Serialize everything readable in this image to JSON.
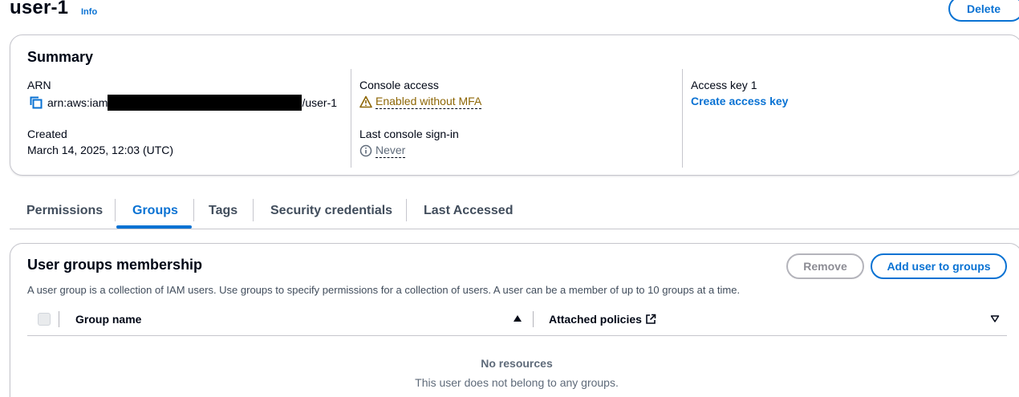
{
  "header": {
    "title": "user-1",
    "info_label": "Info",
    "delete_label": "Delete"
  },
  "summary": {
    "title": "Summary",
    "arn_label": "ARN",
    "arn_prefix": "arn:aws:iam",
    "arn_suffix": "/user-1",
    "created_label": "Created",
    "created_value": "March 14, 2025, 12:03 (UTC)",
    "console_access_label": "Console access",
    "console_access_value": "Enabled without MFA",
    "last_signin_label": "Last console sign-in",
    "last_signin_value": "Never",
    "access_key_label": "Access key 1",
    "create_access_key_label": "Create access key"
  },
  "tabs": [
    {
      "label": "Permissions",
      "active": false
    },
    {
      "label": "Groups",
      "active": true
    },
    {
      "label": "Tags",
      "active": false
    },
    {
      "label": "Security credentials",
      "active": false
    },
    {
      "label": "Last Accessed",
      "active": false
    }
  ],
  "groups": {
    "title": "User groups membership",
    "description": "A user group is a collection of IAM users. Use groups to specify permissions for a collection of users. A user can be a member of up to 10 groups at a time.",
    "remove_label": "Remove",
    "add_label": "Add user to groups",
    "columns": [
      "Group name",
      "Attached policies"
    ],
    "empty_title": "No resources",
    "empty_desc": "This user does not belong to any groups."
  },
  "colors": {
    "link": "#0972d3",
    "warning": "#8d6605",
    "muted": "#5f6b7a",
    "border": "#c6c6cd"
  },
  "icons": [
    "copy-icon",
    "warning-icon",
    "info-circle-icon",
    "sort-ascending-icon",
    "sort-descending-icon",
    "external-link-icon"
  ]
}
